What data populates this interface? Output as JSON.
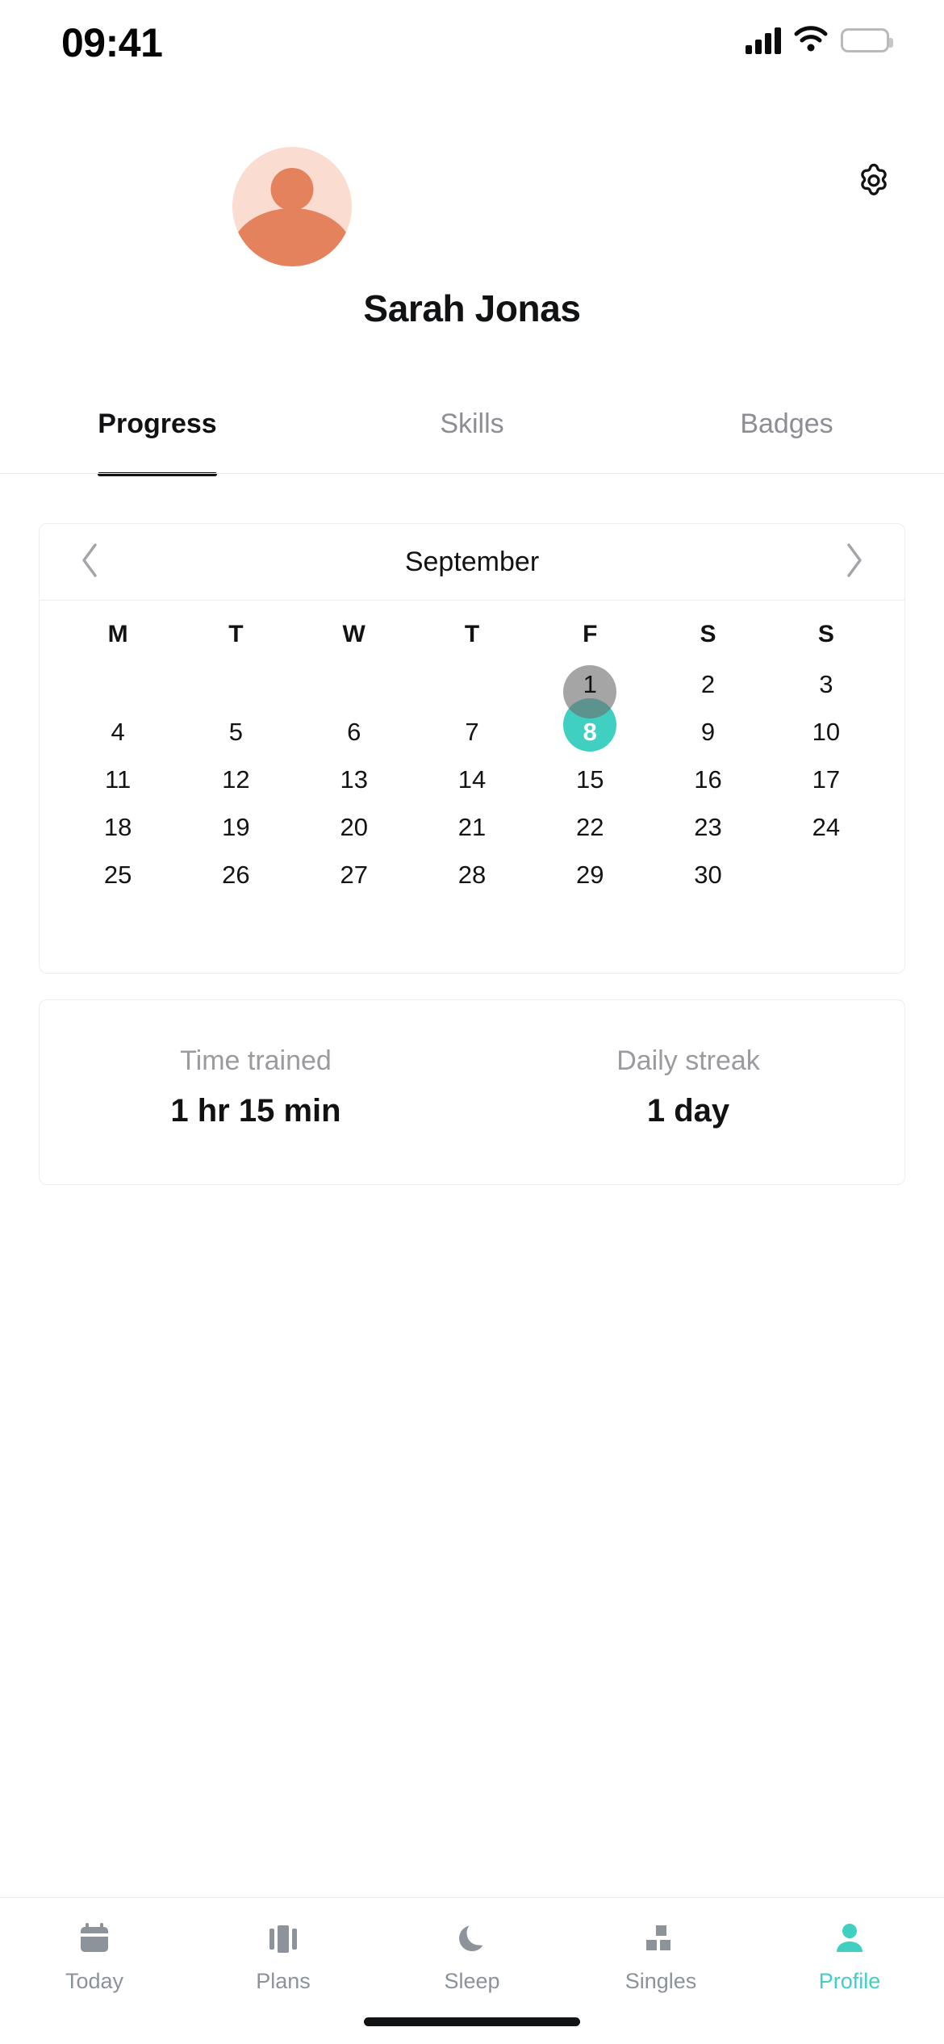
{
  "status_bar": {
    "time": "09:41",
    "signal_icon": "cellular-signal-icon",
    "wifi_icon": "wifi-icon",
    "battery_icon": "battery-icon"
  },
  "header": {
    "settings_icon": "gear-icon",
    "avatar_icon": "avatar-person-icon",
    "profile_name": "Sarah Jonas"
  },
  "tabs": [
    {
      "label": "Progress",
      "active": true
    },
    {
      "label": "Skills",
      "active": false
    },
    {
      "label": "Badges",
      "active": false
    }
  ],
  "calendar": {
    "month": "September",
    "prev_icon": "chevron-left-icon",
    "next_icon": "chevron-right-icon",
    "weekdays": [
      "M",
      "T",
      "W",
      "T",
      "F",
      "S",
      "S"
    ],
    "weeks": [
      [
        "",
        "",
        "",
        "",
        "1",
        "2",
        "3"
      ],
      [
        "4",
        "5",
        "6",
        "7",
        "8",
        "9",
        "10"
      ],
      [
        "11",
        "12",
        "13",
        "14",
        "15",
        "16",
        "17"
      ],
      [
        "18",
        "19",
        "20",
        "21",
        "22",
        "23",
        "24"
      ],
      [
        "25",
        "26",
        "27",
        "28",
        "29",
        "30",
        ""
      ]
    ],
    "marked_days": {
      "gray": "1",
      "teal": "8"
    }
  },
  "stats": [
    {
      "label": "Time trained",
      "value": "1 hr 15 min"
    },
    {
      "label": "Daily streak",
      "value": "1 day"
    }
  ],
  "bottom_nav": [
    {
      "label": "Today",
      "icon": "calendar-icon",
      "active": false
    },
    {
      "label": "Plans",
      "icon": "cards-icon",
      "active": false
    },
    {
      "label": "Sleep",
      "icon": "moon-icon",
      "active": false
    },
    {
      "label": "Singles",
      "icon": "blocks-icon",
      "active": false
    },
    {
      "label": "Profile",
      "icon": "person-icon",
      "active": true
    }
  ],
  "colors": {
    "accent_teal": "#3FD0C1",
    "avatar_bg": "#FBDCD0",
    "avatar_fg": "#E4825D",
    "text_primary": "#121214",
    "text_muted": "#8d8d93",
    "nav_inactive": "#8c929a",
    "marker_gray": "#6E6E70"
  }
}
